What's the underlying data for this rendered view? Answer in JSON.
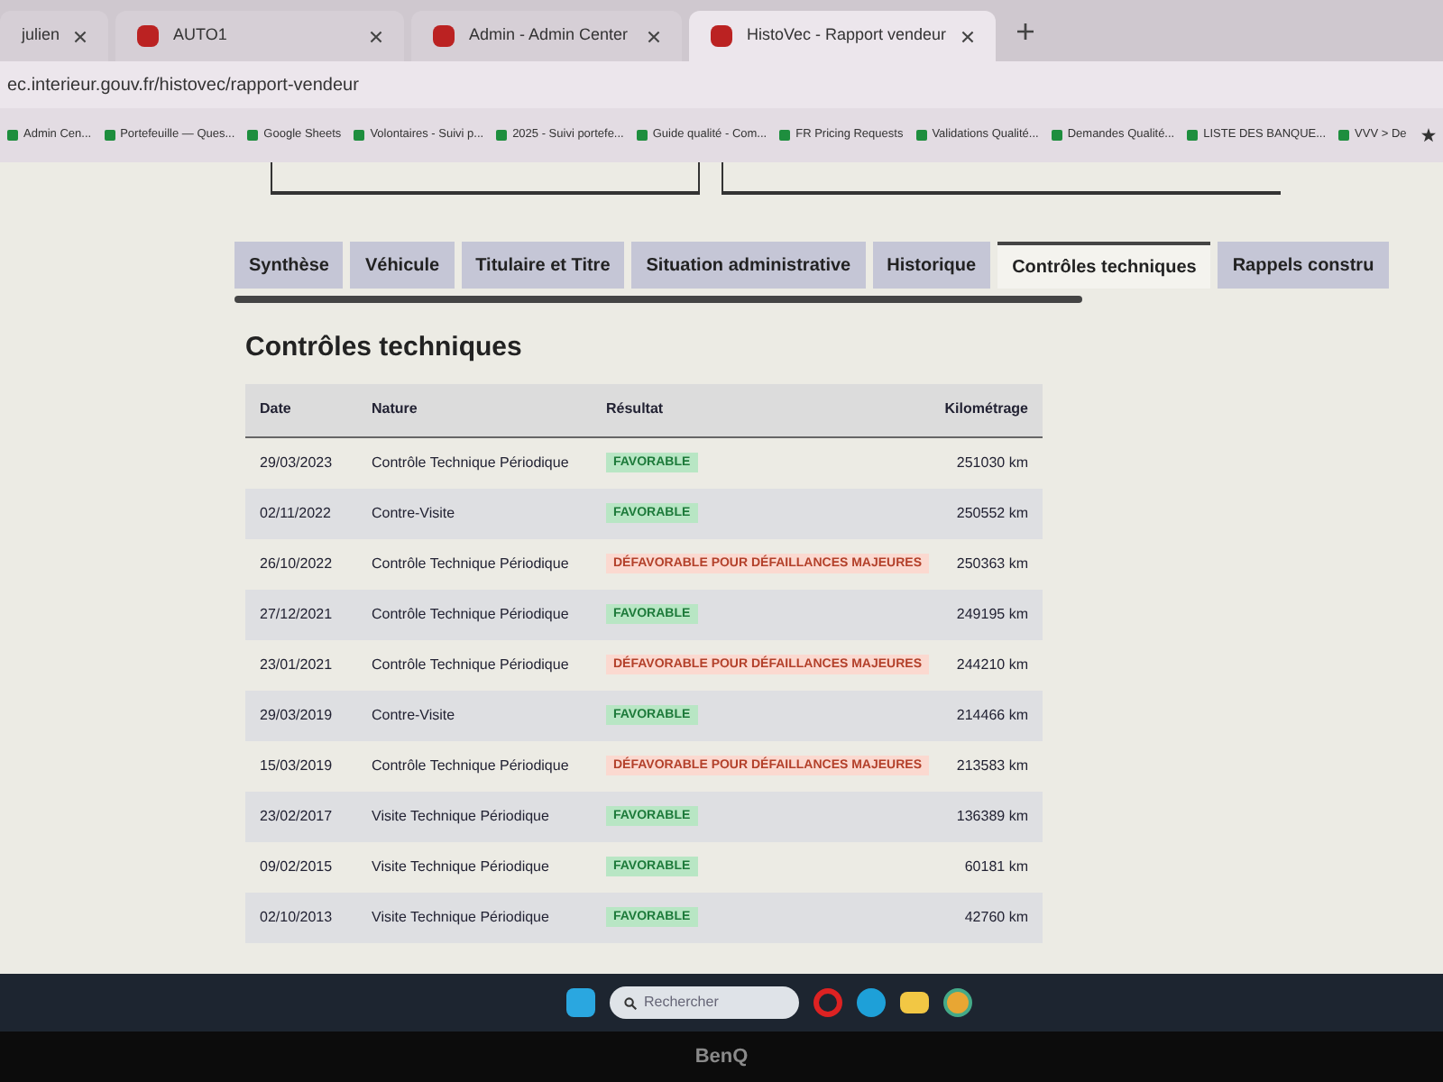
{
  "browser_tabs": [
    {
      "title": "julien",
      "selected": false
    },
    {
      "title": "AUTO1",
      "selected": false
    },
    {
      "title": "Admin - Admin Center",
      "selected": false
    },
    {
      "title": "HistoVec - Rapport vendeur",
      "selected": true
    }
  ],
  "address": "ec.interieur.gouv.fr/histovec/rapport-vendeur",
  "bookmarks": [
    "Admin Cen...",
    "Portefeuille — Ques...",
    "Google Sheets",
    "Volontaires - Suivi p...",
    "2025 - Suivi portefe...",
    "Guide qualité - Com...",
    "FR Pricing Requests",
    "Validations Qualité...",
    "Demandes Qualité...",
    "LISTE DES BANQUE...",
    "VVV > De"
  ],
  "page_tabs": [
    {
      "label": "Synthèse",
      "selected": false
    },
    {
      "label": "Véhicule",
      "selected": false
    },
    {
      "label": "Titulaire et Titre",
      "selected": false
    },
    {
      "label": "Situation administrative",
      "selected": false
    },
    {
      "label": "Historique",
      "selected": false
    },
    {
      "label": "Contrôles techniques",
      "selected": true
    },
    {
      "label": "Rappels constru",
      "selected": false
    }
  ],
  "heading": "Contrôles techniques",
  "table": {
    "columns": [
      "Date",
      "Nature",
      "Résultat",
      "Kilométrage"
    ],
    "rows": [
      {
        "date": "29/03/2023",
        "nature": "Contrôle Technique Périodique",
        "result": {
          "kind": "favorable",
          "text": "FAVORABLE"
        },
        "km": "251030 km"
      },
      {
        "date": "02/11/2022",
        "nature": "Contre-Visite",
        "result": {
          "kind": "favorable",
          "text": "FAVORABLE"
        },
        "km": "250552 km"
      },
      {
        "date": "26/10/2022",
        "nature": "Contrôle Technique Périodique",
        "result": {
          "kind": "defavorable",
          "text": "DÉFAVORABLE POUR DÉFAILLANCES MAJEURES"
        },
        "km": "250363 km"
      },
      {
        "date": "27/12/2021",
        "nature": "Contrôle Technique Périodique",
        "result": {
          "kind": "favorable",
          "text": "FAVORABLE"
        },
        "km": "249195 km"
      },
      {
        "date": "23/01/2021",
        "nature": "Contrôle Technique Périodique",
        "result": {
          "kind": "defavorable",
          "text": "DÉFAVORABLE POUR DÉFAILLANCES MAJEURES"
        },
        "km": "244210 km"
      },
      {
        "date": "29/03/2019",
        "nature": "Contre-Visite",
        "result": {
          "kind": "favorable",
          "text": "FAVORABLE"
        },
        "km": "214466 km"
      },
      {
        "date": "15/03/2019",
        "nature": "Contrôle Technique Périodique",
        "result": {
          "kind": "defavorable",
          "text": "DÉFAVORABLE POUR DÉFAILLANCES MAJEURES"
        },
        "km": "213583 km"
      },
      {
        "date": "23/02/2017",
        "nature": "Visite Technique Périodique",
        "result": {
          "kind": "favorable",
          "text": "FAVORABLE"
        },
        "km": "136389 km"
      },
      {
        "date": "09/02/2015",
        "nature": "Visite Technique Périodique",
        "result": {
          "kind": "favorable",
          "text": "FAVORABLE"
        },
        "km": "60181 km"
      },
      {
        "date": "02/10/2013",
        "nature": "Visite Technique Périodique",
        "result": {
          "kind": "favorable",
          "text": "FAVORABLE"
        },
        "km": "42760 km"
      }
    ]
  },
  "taskbar": {
    "search_placeholder": "Rechercher"
  },
  "monitor_brand": "BenQ"
}
